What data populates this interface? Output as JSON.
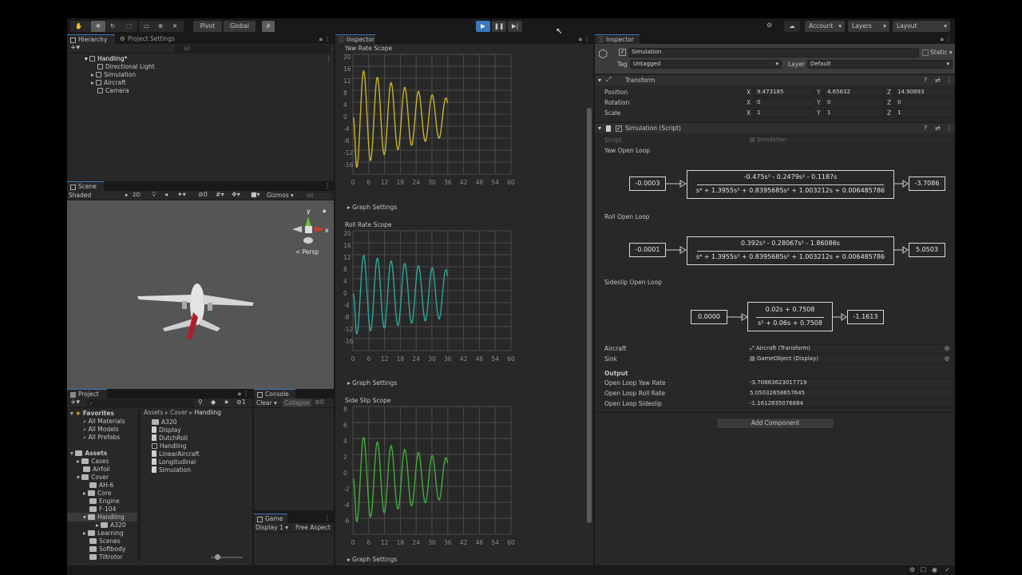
{
  "toolbar": {
    "pivot": "Pivot",
    "global": "Global",
    "account": "Account",
    "layers": "Layers",
    "layout": "Layout"
  },
  "hierarchy": {
    "tab": "Hierarchy",
    "tab2": "Project Settings",
    "search_placeholder": "All",
    "scene_name": "Handling*",
    "items": [
      "Directional Light",
      "Simulation",
      "Aircraft",
      "Camera"
    ]
  },
  "scene": {
    "tab": "Scene",
    "shading": "Shaded",
    "mode2d": "2D",
    "gizmos": "Gizmos",
    "search_placeholder": "All",
    "persp": "Persp",
    "axis_y": "y",
    "axis_x": "x",
    "hidden_count": "0"
  },
  "project": {
    "tab": "Project",
    "console_tab": "Console",
    "clear": "Clear",
    "collapse": "Collapse",
    "error_count": "0",
    "count": "1",
    "favorites": "Favorites",
    "favorite_items": [
      "All Materials",
      "All Models",
      "All Prefabs"
    ],
    "assets": "Assets",
    "asset_tree": [
      "Cases",
      "Airfoil",
      "Cover",
      "AH-6",
      "Core",
      "Engine",
      "F-104",
      "Handling",
      "A320",
      "Learning",
      "Scenes",
      "Softbody",
      "Tiltrotor"
    ],
    "breadcrumb": [
      "Assets",
      "Cover",
      "Handling"
    ],
    "files": [
      "A320",
      "Display",
      "DutchRoll",
      "Handling",
      "LinearAircraft",
      "Longitudinal",
      "Simulation"
    ]
  },
  "game": {
    "tab": "Game",
    "display": "Display 1",
    "aspect": "Free Aspect"
  },
  "scopes_inspector": {
    "tab": "Inspector",
    "graph_settings": "Graph Settings"
  },
  "chart_data": [
    {
      "type": "line",
      "title": "Yaw Rate Scope",
      "x_ticks": [
        "0",
        "6",
        "12",
        "18",
        "24",
        "30",
        "36",
        "42",
        "48",
        "54",
        "60"
      ],
      "y_ticks": [
        "20",
        "16",
        "12",
        "8",
        "4",
        "0",
        "-4",
        "-8",
        "-12",
        "-16"
      ],
      "xlim": [
        0,
        60
      ],
      "ylim": [
        -18,
        20
      ],
      "color": "#c8b22a",
      "series": [
        {
          "amp": 16.5,
          "period": 5.2,
          "decay": 0.028,
          "x_end": 36,
          "values_desc": "damped oscillation"
        }
      ]
    },
    {
      "type": "line",
      "title": "Roll Rate Scope",
      "x_ticks": [
        "0",
        "6",
        "12",
        "18",
        "24",
        "30",
        "36",
        "42",
        "48",
        "54",
        "60"
      ],
      "y_ticks": [
        "20",
        "16",
        "12",
        "8",
        "4",
        "0",
        "-4",
        "-8",
        "-12",
        "-16"
      ],
      "xlim": [
        0,
        60
      ],
      "ylim": [
        -18,
        20
      ],
      "color": "#2aa89a",
      "series": [
        {
          "amp": 13,
          "period": 5.2,
          "decay": 0.015,
          "x_end": 36
        }
      ]
    },
    {
      "type": "line",
      "title": "Side Slip Scope",
      "x_ticks": [
        "0",
        "6",
        "12",
        "18",
        "24",
        "30",
        "36",
        "42",
        "48",
        "54",
        "60"
      ],
      "y_ticks": [
        "8",
        "6",
        "4",
        "2",
        "0",
        "-2",
        "-4",
        "-6"
      ],
      "xlim": [
        0,
        60
      ],
      "ylim": [
        -7,
        9
      ],
      "color": "#3fae3a",
      "series": [
        {
          "amp": 5.6,
          "period": 5.2,
          "decay": 0.022,
          "x_end": 36
        }
      ]
    }
  ],
  "inspector": {
    "tab": "Inspector",
    "object_name": "Simulation",
    "static": "Static",
    "tag_label": "Tag",
    "tag": "Untagged",
    "layer_label": "Layer",
    "layer": "Default",
    "transform": {
      "title": "Transform",
      "position_label": "Position",
      "rotation_label": "Rotation",
      "scale_label": "Scale",
      "position": [
        "9.473185",
        "4.65632",
        "14.90893"
      ],
      "rotation": [
        "0",
        "0",
        "0"
      ],
      "scale": [
        "1",
        "1",
        "1"
      ],
      "axes": [
        "X",
        "Y",
        "Z"
      ]
    },
    "script": {
      "title": "Simulation (Script)",
      "script_label": "Script",
      "script_value": "Simulation",
      "yaw_title": "Yaw Open Loop",
      "yaw_in": "-0.0003",
      "yaw_num": "-0.475s³ - 0.2479s² - 0.1187s",
      "yaw_den": "s⁴ + 1.3955s³ + 0.8395685s² + 1.003212s + 0.006485786",
      "yaw_out": "-3.7086",
      "roll_title": "Roll Open Loop",
      "roll_in": "-0.0001",
      "roll_num": "0.392s³ - 0.28067s² - 1.86086s",
      "roll_den": "s⁴ + 1.3955s³ + 0.8395685s² + 1.003212s + 0.006485786",
      "roll_out": "5.0503",
      "side_title": "Sideslip Open Loop",
      "side_in": "0.0000",
      "side_num": "0.02s + 0.7508",
      "side_den": "s² + 0.06s + 0.7508",
      "side_out": "-1.1613",
      "aircraft_label": "Aircraft",
      "aircraft_value": "Aircraft (Transform)",
      "sink_label": "Sink",
      "sink_value": "GameObject (Display)",
      "output_label": "Output",
      "out_yaw_label": "Open Loop Yaw Rate",
      "out_yaw": "-3.70863623017719",
      "out_roll_label": "Open Loop Roll Rate",
      "out_roll": "5.05032658657645",
      "out_side_label": "Open Loop Sideslip",
      "out_side": "-1.1612835076884"
    },
    "add_component": "Add Component"
  },
  "colors": {
    "bg": "#191919",
    "panel": "#282828",
    "accent": "#3a79bb",
    "play_active": "#3a79bb"
  }
}
